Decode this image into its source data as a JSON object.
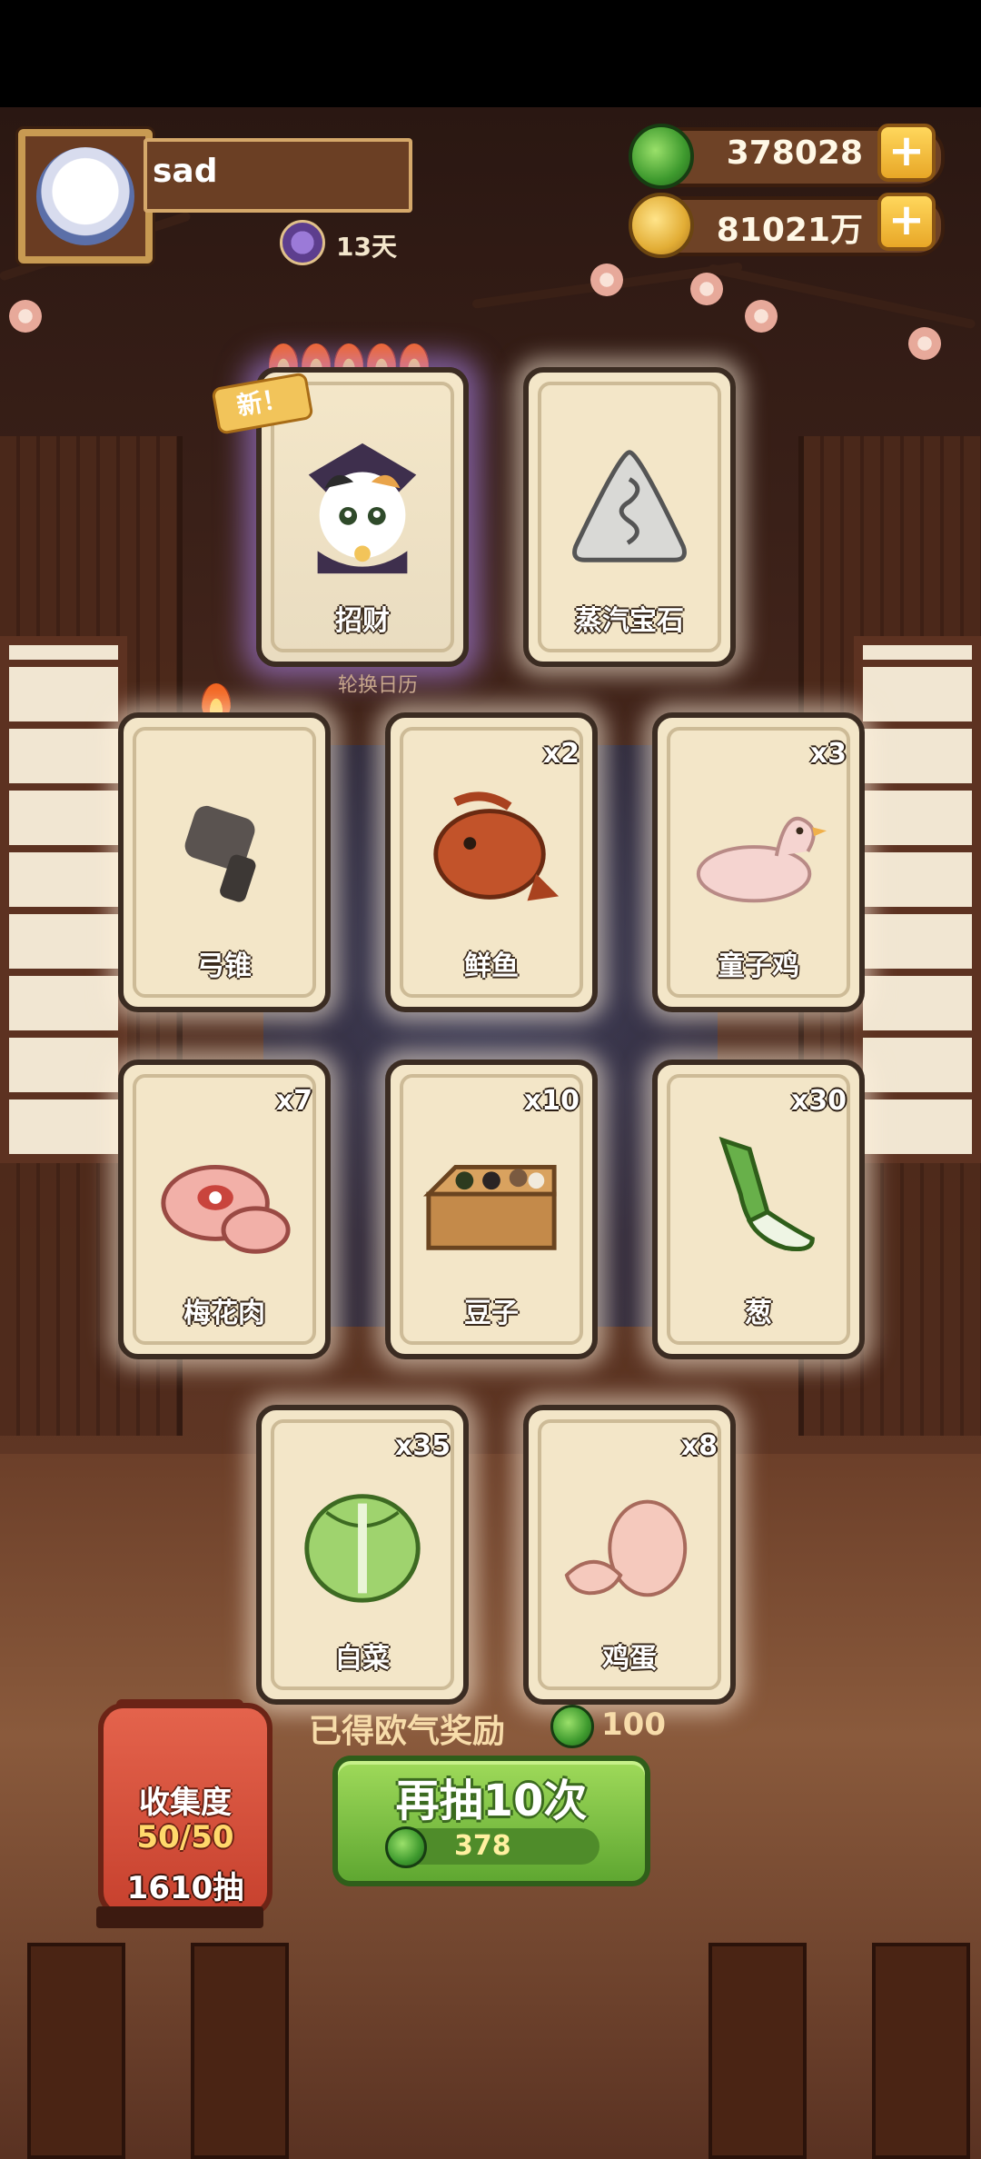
{
  "player": {
    "name": "sad",
    "days_label": "13天",
    "avatar_icon": "white-cat-avatar-icon"
  },
  "currency": {
    "jade_amount": "378028",
    "coin_amount": "81021万",
    "jade_icon": "jade-icon",
    "coin_icon": "coin-icon",
    "plus_symbol": "+"
  },
  "badge": {
    "new_label": "新！",
    "subtext": "轮换日历"
  },
  "cards": [
    {
      "label": "招财",
      "qty": "",
      "icon": "calico-cat-icon",
      "flames": 5,
      "isNew": true
    },
    {
      "label": "蒸汽宝石",
      "qty": "",
      "icon": "steam-gem-icon",
      "flames": 0
    },
    {
      "label": "弓锥",
      "qty": "",
      "icon": "awl-icon",
      "flames": 1
    },
    {
      "label": "鲜鱼",
      "qty": "x2",
      "icon": "fish-icon",
      "flames": 0
    },
    {
      "label": "童子鸡",
      "qty": "x3",
      "icon": "chicken-icon",
      "flames": 0
    },
    {
      "label": "梅花肉",
      "qty": "x7",
      "icon": "pork-icon",
      "flames": 0
    },
    {
      "label": "豆子",
      "qty": "x10",
      "icon": "beans-icon",
      "flames": 0
    },
    {
      "label": "葱",
      "qty": "x30",
      "icon": "scallion-icon",
      "flames": 0
    },
    {
      "label": "白菜",
      "qty": "x35",
      "icon": "cabbage-icon",
      "flames": 0
    },
    {
      "label": "鸡蛋",
      "qty": "x8",
      "icon": "egg-icon",
      "flames": 0
    }
  ],
  "reward": {
    "label": "已得欧气奖励",
    "value": "100",
    "icon": "jade-icon"
  },
  "draw_button": {
    "label": "再抽10次",
    "cost": "378",
    "cost_icon": "jade-icon"
  },
  "collection": {
    "title": "收集度",
    "count": "50/50",
    "draws": "1610抽"
  },
  "colors": {
    "accent_green": "#5fa731",
    "gold": "#f2c45a",
    "card_bg": "#f3e6c8"
  }
}
